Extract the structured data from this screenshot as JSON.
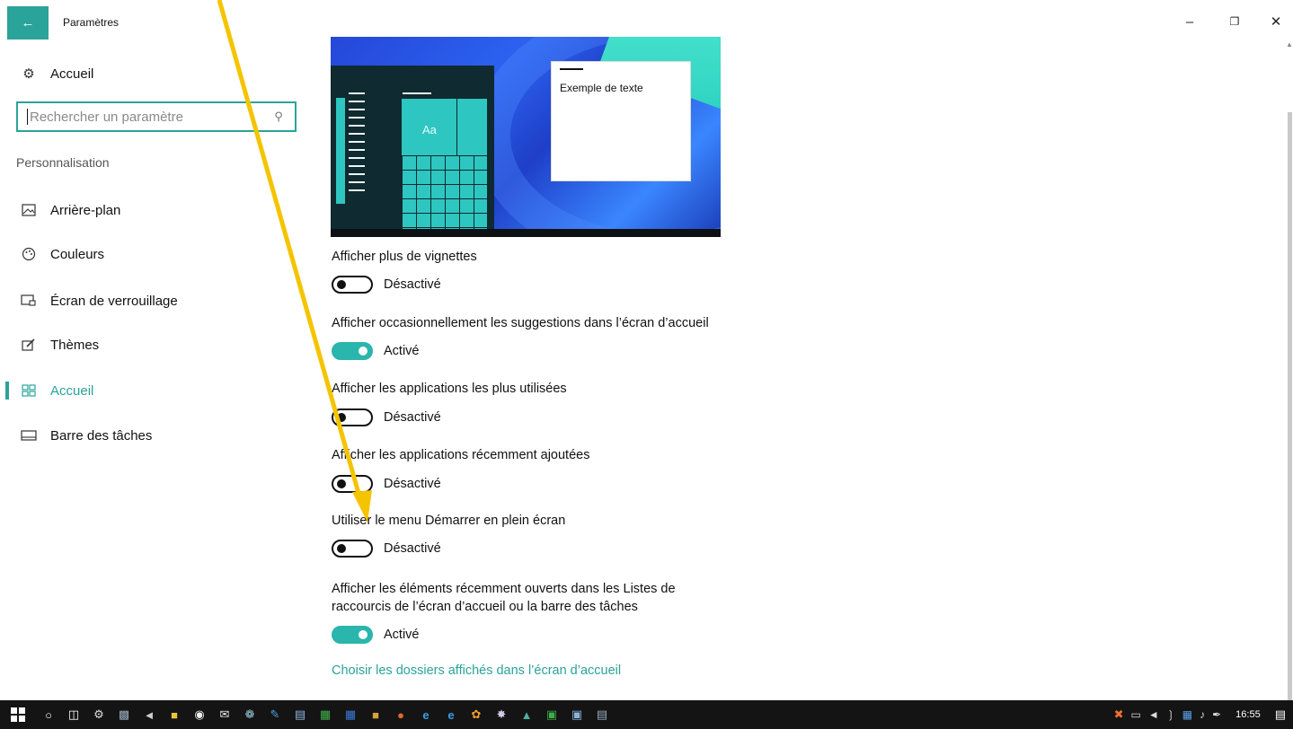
{
  "window": {
    "title": "Paramètres",
    "back_icon": "arrow-left-icon",
    "controls": [
      "minimize-icon",
      "restore-icon",
      "close-icon"
    ]
  },
  "sidebar": {
    "home_label": "Accueil",
    "search": {
      "placeholder": "Rechercher un paramètre"
    },
    "section": "Personnalisation",
    "items": [
      {
        "label": "Arrière-plan",
        "icon": "picture-icon"
      },
      {
        "label": "Couleurs",
        "icon": "palette-icon"
      },
      {
        "label": "Écran de verrouillage",
        "icon": "lockscreen-icon"
      },
      {
        "label": "Thèmes",
        "icon": "themes-icon"
      },
      {
        "label": "Accueil",
        "icon": "start-icon",
        "active": true
      },
      {
        "label": "Barre des tâches",
        "icon": "taskbar-icon"
      }
    ]
  },
  "preview": {
    "tile_text": "Aa",
    "sample_text": "Exemple de texte"
  },
  "settings": [
    {
      "label": "Afficher plus de vignettes",
      "state": "Désactivé",
      "on": false
    },
    {
      "label": "Afficher occasionnellement les suggestions dans l’écran d’accueil",
      "state": "Activé",
      "on": true
    },
    {
      "label": "Afficher les applications les plus utilisées",
      "state": "Désactivé",
      "on": false
    },
    {
      "label": "Afficher les applications récemment ajoutées",
      "state": "Désactivé",
      "on": false
    },
    {
      "label": "Utiliser le menu Démarrer en plein écran",
      "state": "Désactivé",
      "on": false
    },
    {
      "label_line1": "Afficher les éléments récemment ouverts dans les Listes de",
      "label_line2": "raccourcis de l’écran d’accueil ou la barre des tâches",
      "state": "Activé",
      "on": true
    }
  ],
  "link": "Choisir les dossiers affichés dans l’écran d’accueil",
  "taskbar": {
    "clock": "16:55",
    "colors": {
      "accent": "#2aa39a",
      "arrow": "#f5c400"
    }
  }
}
